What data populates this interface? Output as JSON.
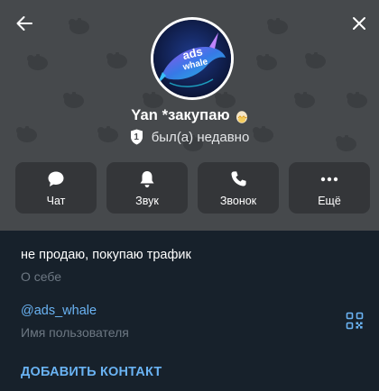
{
  "profile": {
    "name": "Yan *закупаю",
    "status": "был(а) недавно",
    "badge_number": "1",
    "avatar_text_line1": "ads",
    "avatar_text_line2": "whale"
  },
  "actions": [
    {
      "label": "Чат",
      "icon": "chat-icon"
    },
    {
      "label": "Звук",
      "icon": "bell-icon"
    },
    {
      "label": "Звонок",
      "icon": "phone-icon"
    },
    {
      "label": "Ещё",
      "icon": "more-icon"
    }
  ],
  "bio": {
    "text": "не продаю, покупаю трафик",
    "caption": "О себе"
  },
  "username": {
    "text": "@ads_whale",
    "caption": "Имя пользователя"
  },
  "add_contact_label": "ДОБАВИТЬ КОНТАКТ",
  "colors": {
    "header_bg": "#46494c",
    "panel_bg": "#17212b",
    "link": "#6ab3f3",
    "secondary_text": "#6d7883"
  }
}
